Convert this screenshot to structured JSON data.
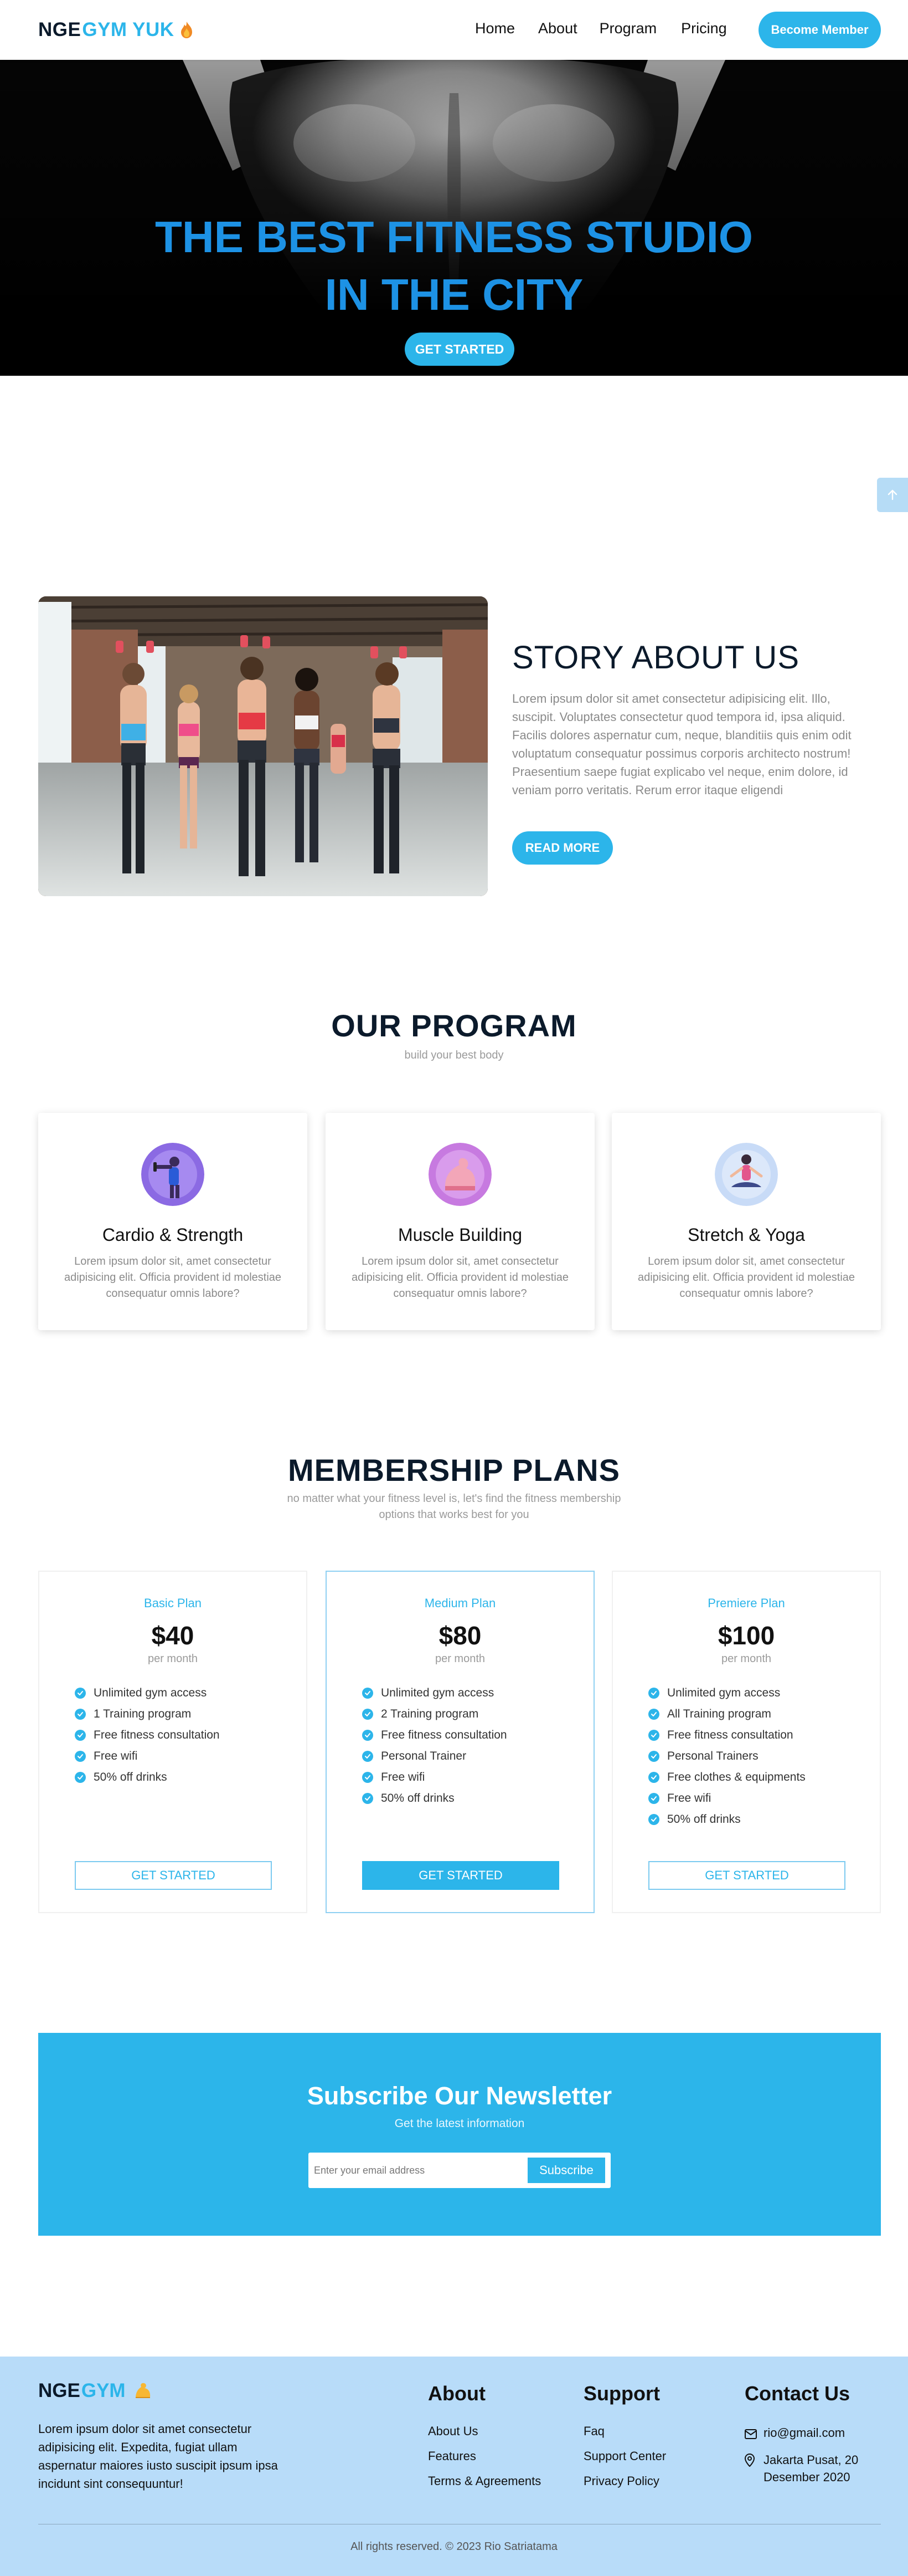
{
  "brand": {
    "part1": "NGE",
    "part2": "GYM YUK"
  },
  "nav": {
    "items": [
      "Home",
      "About",
      "Program",
      "Pricing"
    ],
    "cta": "Become Member"
  },
  "hero": {
    "line1": "THE BEST FITNESS STUDIO",
    "line2": "IN THE CITY",
    "button": "GET STARTED"
  },
  "story": {
    "title": "STORY ABOUT US",
    "text": "Lorem ipsum dolor sit amet consectetur adipisicing elit. Illo, suscipit. Voluptates consectetur quod tempora id, ipsa aliquid. Facilis dolores aspernatur cum, neque, blanditiis quis enim odit voluptatum consequatur possimus corporis architecto nostrum! Praesentium saepe fugiat explicabo vel neque, enim dolore, id veniam porro veritatis. Rerum error itaque eligendi",
    "button": "READ MORE"
  },
  "program": {
    "title": "OUR PROGRAM",
    "subtitle": "build your best body",
    "cards": [
      {
        "title": "Cardio & Strength",
        "desc": "Lorem ipsum dolor sit, amet consectetur adipisicing elit. Officia provident id molestiae consequatur omnis labore?",
        "icon": "dumbbell-person-icon"
      },
      {
        "title": "Muscle Building",
        "desc": "Lorem ipsum dolor sit, amet consectetur adipisicing elit. Officia provident id molestiae consequatur omnis labore?",
        "icon": "flexed-arm-icon"
      },
      {
        "title": "Stretch & Yoga",
        "desc": "Lorem ipsum dolor sit, amet consectetur adipisicing elit. Officia provident id molestiae consequatur omnis labore?",
        "icon": "yoga-pose-icon"
      }
    ]
  },
  "membership": {
    "title": "MEMBERSHIP PLANS",
    "subtitle_line1": "no matter what your fitness level is, let's find the fitness membership",
    "subtitle_line2": "options that works best for you",
    "plans": [
      {
        "name": "Basic Plan",
        "price": "$40",
        "period": "per month",
        "button": "GET STARTED",
        "features": [
          "Unlimited gym access",
          "1 Training program",
          "Free fitness consultation",
          "Free wifi",
          "50% off drinks"
        ]
      },
      {
        "name": "Medium Plan",
        "price": "$80",
        "period": "per month",
        "button": "GET STARTED",
        "features": [
          "Unlimited gym access",
          "2 Training program",
          "Free fitness consultation",
          "Personal Trainer",
          "Free wifi",
          "50% off drinks"
        ]
      },
      {
        "name": "Premiere Plan",
        "price": "$100",
        "period": "per month",
        "button": "GET STARTED",
        "features": [
          "Unlimited gym access",
          "All Training program",
          "Free fitness consultation",
          "Personal Trainers",
          "Free clothes & equipments",
          "Free wifi",
          "50% off drinks"
        ]
      }
    ]
  },
  "newsletter": {
    "title": "Subscribe Our Newsletter",
    "subtitle": "Get the latest information",
    "placeholder": "Enter your email address",
    "button": "Subscribe"
  },
  "footer": {
    "brand": {
      "part1": "NGE",
      "part2": "GYM"
    },
    "about": "Lorem ipsum dolor sit amet consectetur adipisicing elit. Expedita, fugiat ullam aspernatur maiores iusto suscipit ipsum ipsa incidunt sint consequuntur!",
    "about_col": {
      "title": "About",
      "links": [
        "About Us",
        "Features",
        "Terms & Agreements"
      ]
    },
    "support_col": {
      "title": "Support",
      "links": [
        "Faq",
        "Support Center",
        "Privacy Policy"
      ]
    },
    "contact_col": {
      "title": "Contact Us",
      "email": "rio@gmail.com",
      "address_line1": "Jakarta Pusat, 20",
      "address_line2": "Desember 2020"
    },
    "copyright": "All rights reserved. © 2023 Rio Satriatama"
  },
  "colors": {
    "accent": "#2cb5ea",
    "hero_title": "#1d92e5",
    "footer_bg": "#b8dcf9",
    "navy": "#0b1a2b"
  }
}
